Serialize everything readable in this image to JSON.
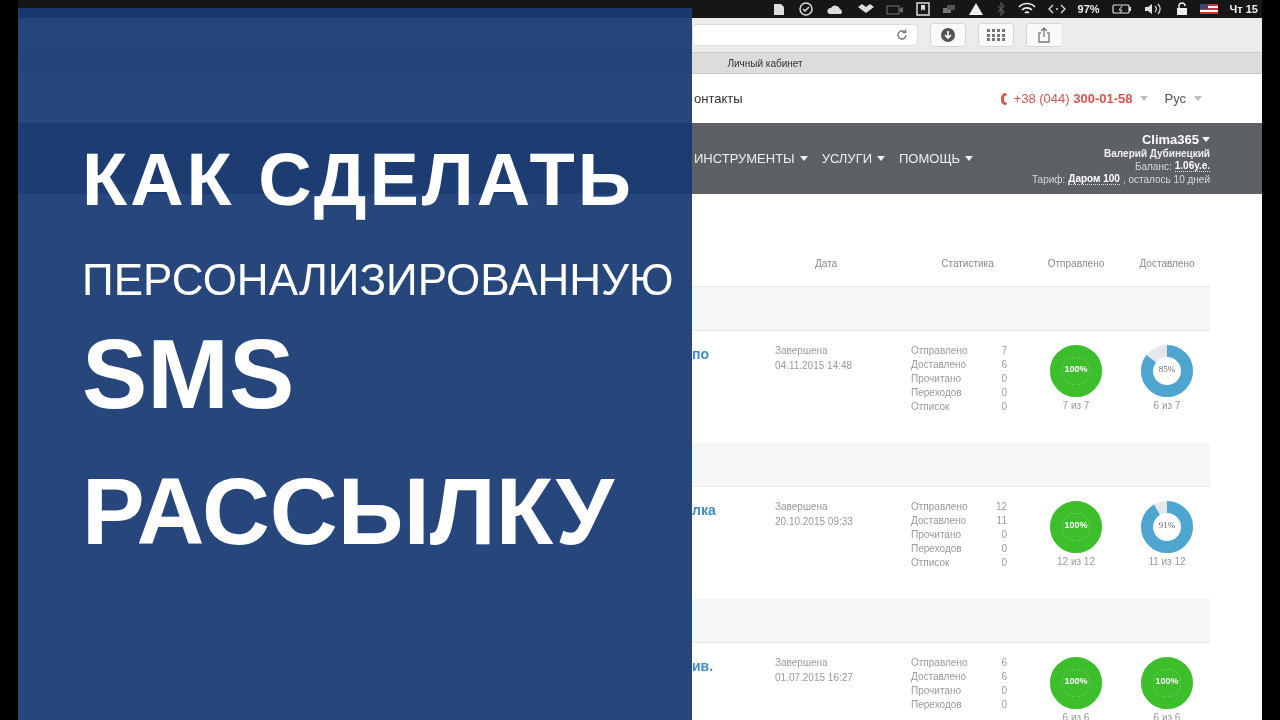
{
  "menu_bar": {
    "battery_percent": "97%",
    "clock": "Чт 15"
  },
  "browser": {
    "tab_title": "Личный кабинет"
  },
  "site_header": {
    "nav_link": "онтакты",
    "phone": "+38 (044) **300-01-58**",
    "language": "Рус"
  },
  "main_nav": {
    "items": [
      "ИНСТРУМЕНТЫ",
      "УСЛУГИ",
      "ПОМОЩЬ"
    ],
    "account": "Clima365",
    "user_name": "Валерий Дубинецкий",
    "balance_label": "Баланс:",
    "balance": "1.06у.е.",
    "tariff_label": "Тариф:",
    "tariff": "Даром 100",
    "tariff_rest": ", осталось 10 дней"
  },
  "table": {
    "columns": [
      "Дата",
      "Статистика",
      "Отправлено",
      "Доставлено"
    ],
    "rows": [
      {
        "title": "по",
        "status": "Завершена",
        "date": "04.11.2015 14:48",
        "stats": [
          {
            "label": "Отправлено",
            "value": "7"
          },
          {
            "label": "Доставлено",
            "value": "6"
          },
          {
            "label": "Прочитано",
            "value": "0"
          },
          {
            "label": "Переходов",
            "value": "0"
          },
          {
            "label": "Отписок",
            "value": "0"
          }
        ],
        "sent": {
          "kind": "solid",
          "label": "100%",
          "caption": "7 из 7",
          "level": 1
        },
        "delivered": {
          "kind": "donut",
          "label": "85%",
          "caption": "6 из 7",
          "level": 0.85
        }
      },
      {
        "title": "лка",
        "status": "Завершена",
        "date": "20.10.2015 09:33",
        "stats": [
          {
            "label": "Отправлено",
            "value": "12"
          },
          {
            "label": "Доставлено",
            "value": "11"
          },
          {
            "label": "Прочитано",
            "value": "0"
          },
          {
            "label": "Переходов",
            "value": "0"
          },
          {
            "label": "Отписок",
            "value": "0"
          }
        ],
        "sent": {
          "kind": "solid",
          "label": "100%",
          "caption": "12 из 12",
          "level": 1
        },
        "delivered": {
          "kind": "donut",
          "label": "91%",
          "caption": "11 из 12",
          "level": 0.91
        }
      },
      {
        "title": "ив.",
        "status": "Завершена",
        "date": "01.07.2015 16:27",
        "stats": [
          {
            "label": "Отправлено",
            "value": "6"
          },
          {
            "label": "Доставлено",
            "value": "6"
          },
          {
            "label": "Прочитано",
            "value": "0"
          },
          {
            "label": "Переходов",
            "value": "0"
          }
        ],
        "sent": {
          "kind": "solid",
          "label": "100%",
          "caption": "6 из 6",
          "level": 1
        },
        "delivered": {
          "kind": "solid",
          "label": "100%",
          "caption": "6 из 6",
          "level": 1
        }
      }
    ]
  },
  "overlay": {
    "lines": [
      {
        "text": "КАК СДЕЛАТЬ",
        "kind": "bold"
      },
      {
        "text": "ПЕРСОНАЛИЗИРОВАННУЮ",
        "kind": "light"
      },
      {
        "text": "SMS",
        "kind": "bold-xl"
      },
      {
        "text": "РАССЫЛКУ",
        "kind": "bold-xl"
      }
    ]
  }
}
